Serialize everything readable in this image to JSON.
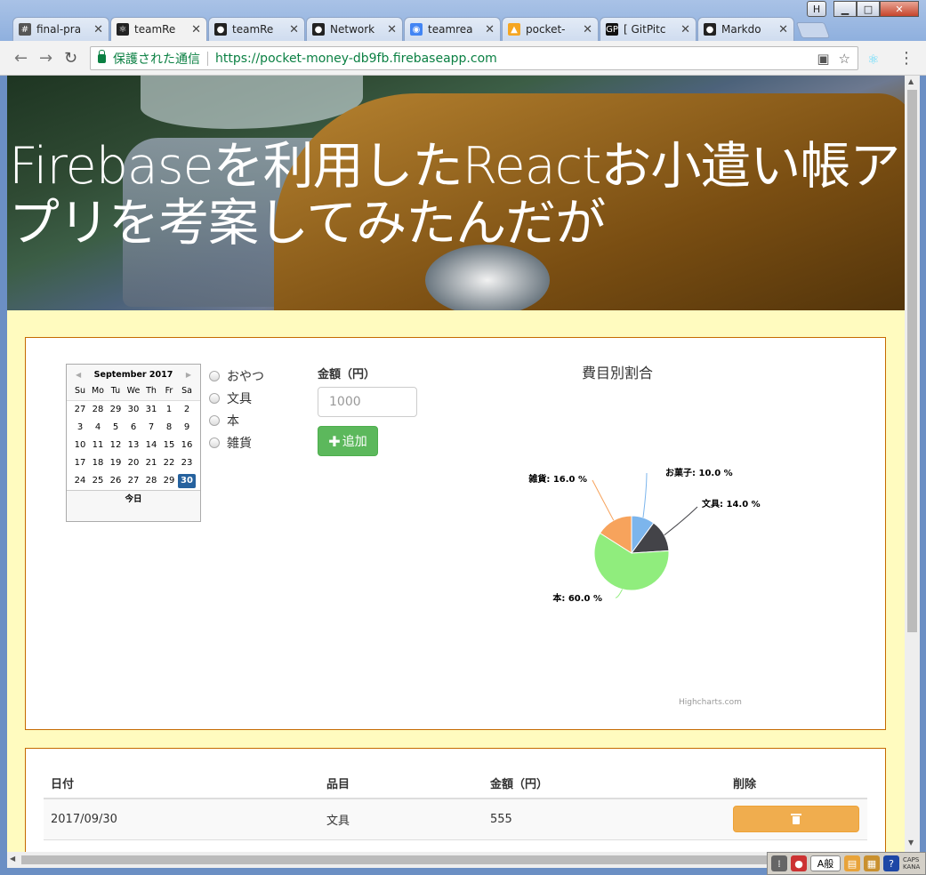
{
  "browser": {
    "tabs": [
      {
        "label": "final-pra",
        "icon": "hash-icon",
        "active": false
      },
      {
        "label": "teamRe",
        "icon": "react-icon",
        "active": true
      },
      {
        "label": "teamRe",
        "icon": "github-icon",
        "active": false
      },
      {
        "label": "Network",
        "icon": "github-icon",
        "active": false
      },
      {
        "label": "teamrea",
        "icon": "eye-icon",
        "active": false
      },
      {
        "label": "pocket-",
        "icon": "firebase-icon",
        "active": false
      },
      {
        "label": "[ GitPitc",
        "icon": "gitpitch-icon",
        "active": false
      },
      {
        "label": "Markdo",
        "icon": "github-icon",
        "active": false
      }
    ],
    "secure_label": "保護された通信",
    "url": "https://pocket-money-db9fb.firebaseapp.com"
  },
  "hero": {
    "title": "Firebaseを利用したReactお小遣い帳アプリを考案してみたんだが"
  },
  "calendar": {
    "month_label": "September 2017",
    "weekdays": [
      "Su",
      "Mo",
      "Tu",
      "We",
      "Th",
      "Fr",
      "Sa"
    ],
    "days": [
      "27",
      "28",
      "29",
      "30",
      "31",
      "1",
      "2",
      "3",
      "4",
      "5",
      "6",
      "7",
      "8",
      "9",
      "10",
      "11",
      "12",
      "13",
      "14",
      "15",
      "16",
      "17",
      "18",
      "19",
      "20",
      "21",
      "22",
      "23",
      "24",
      "25",
      "26",
      "27",
      "28",
      "29",
      "30"
    ],
    "selected_day": "30",
    "today_label": "今日"
  },
  "categories": [
    "おやつ",
    "文具",
    "本",
    "雑貨"
  ],
  "form": {
    "amount_label": "金額（円）",
    "amount_placeholder": "1000",
    "add_label": "追加"
  },
  "chart_data": {
    "type": "pie",
    "title": "費目別割合",
    "slices": [
      {
        "label": "お菓子",
        "value": 10.0,
        "color": "#7cb5ec"
      },
      {
        "label": "文具",
        "value": 14.0,
        "color": "#434348"
      },
      {
        "label": "本",
        "value": 60.0,
        "color": "#90ed7d"
      },
      {
        "label": "雑貨",
        "value": 16.0,
        "color": "#f7a35c"
      }
    ],
    "data_label_suffix": " %",
    "credit": "Highcharts.com"
  },
  "table": {
    "headers": [
      "日付",
      "品目",
      "金額（円）",
      "削除"
    ],
    "rows": [
      {
        "date": "2017/09/30",
        "item": "文具",
        "amount": "555"
      }
    ]
  }
}
